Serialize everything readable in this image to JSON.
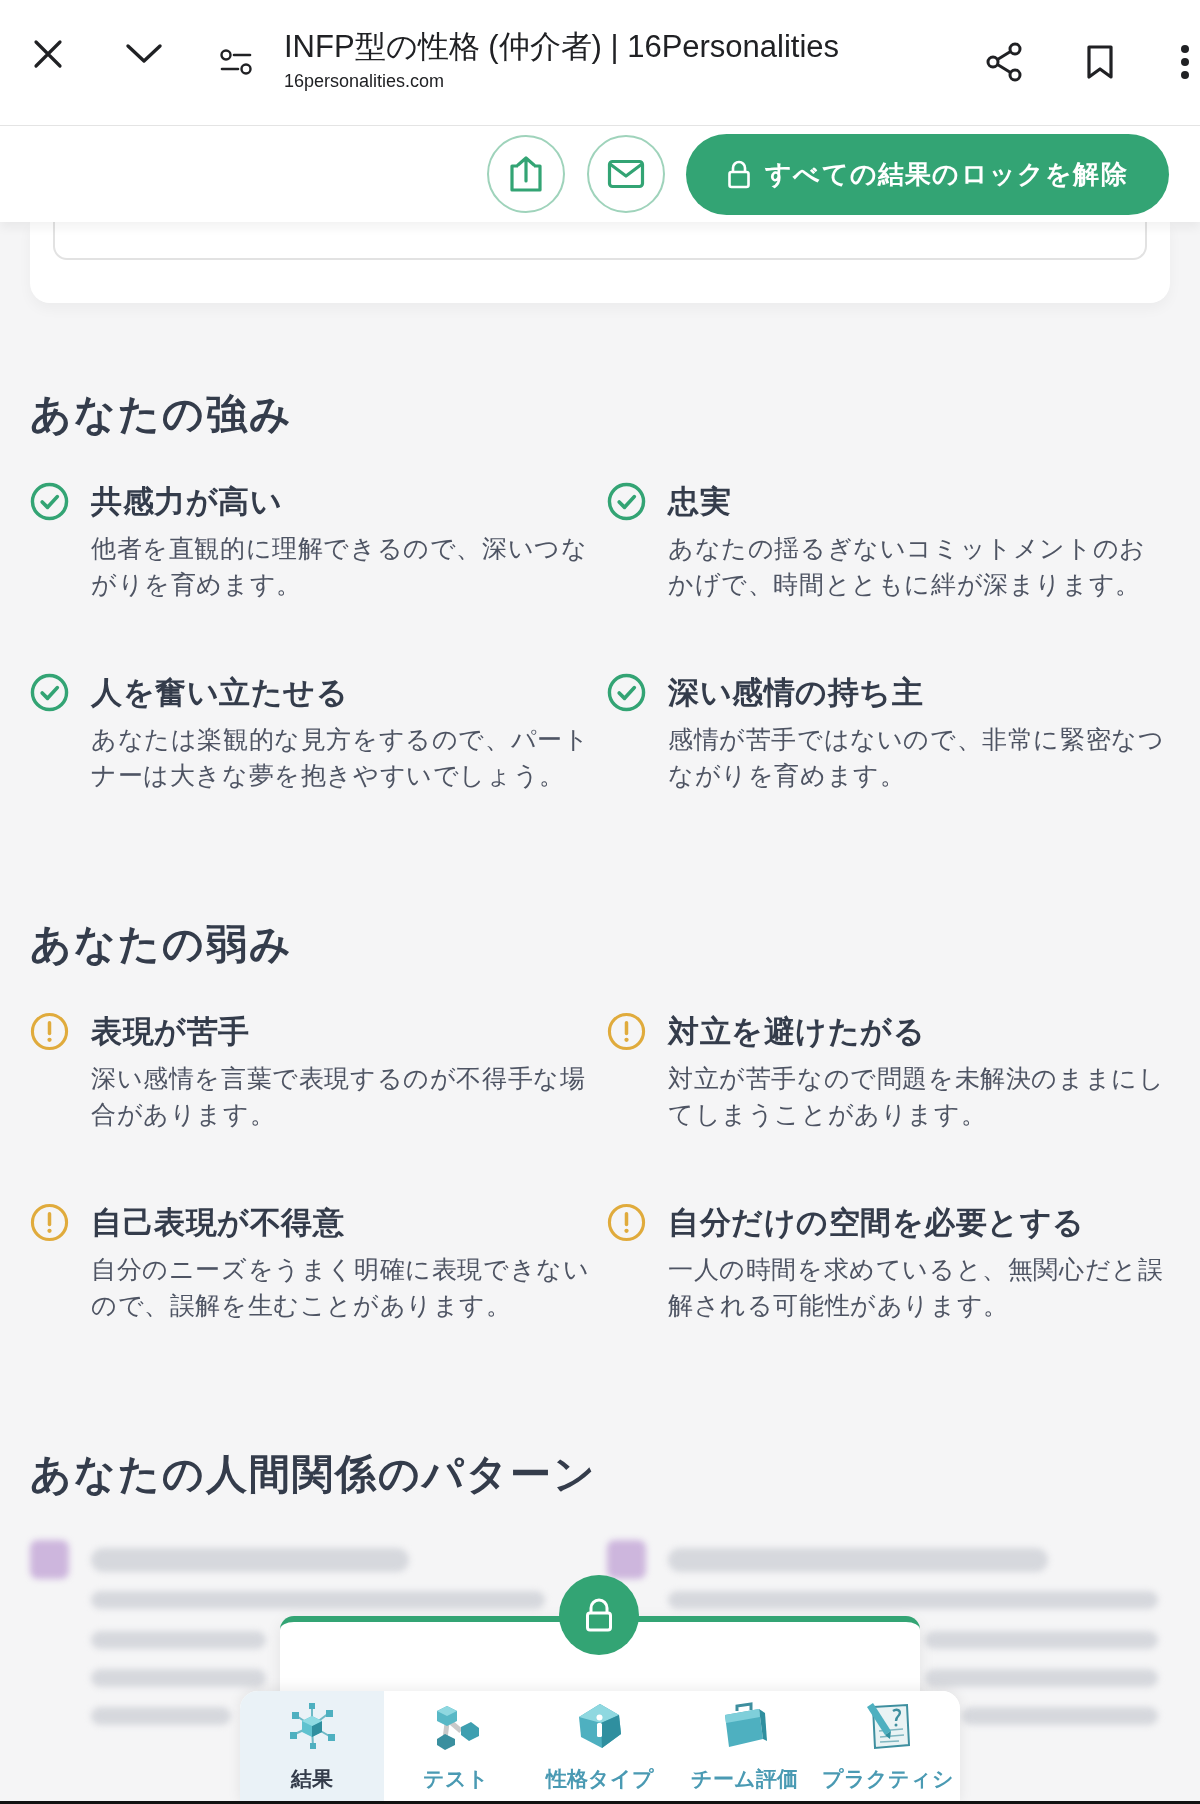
{
  "browser_bar": {
    "title": "INFP型の性格 (仲介者) | 16Personalities",
    "url": "16personalities.com"
  },
  "action_bar": {
    "unlock_button": "すべての結果のロックを解除"
  },
  "sections": [
    {
      "kind": "strengths",
      "heading": "あなたの強み",
      "items": [
        {
          "title": "共感力が高い",
          "text": "他者を直観的に理解できるので、深いつながりを育めます。"
        },
        {
          "title": "忠実",
          "text": "あなたの揺るぎないコミットメントのおかげで、時間とともに絆が深まります。"
        },
        {
          "title": "人を奮い立たせる",
          "text": "あなたは楽観的な見方をするので、パートナーは大きな夢を抱きやすいでしょう。"
        },
        {
          "title": "深い感情の持ち主",
          "text": "感情が苦手ではないので、非常に緊密なつながりを育めます。"
        }
      ]
    },
    {
      "kind": "weaknesses",
      "heading": "あなたの弱み",
      "items": [
        {
          "title": "表現が苦手",
          "text": "深い感情を言葉で表現するのが不得手な場合があります。"
        },
        {
          "title": "対立を避けたがる",
          "text": "対立が苦手なので問題を未解決のままにしてしまうことがあります。"
        },
        {
          "title": "自己表現が不得意",
          "text": "自分のニーズをうまく明確に表現できないので、誤解を生むことがあります。"
        },
        {
          "title": "自分だけの空間を必要とする",
          "text": "一人の時間を求めていると、無関心だと誤解される可能性があります。"
        }
      ]
    },
    {
      "kind": "locked",
      "heading": "あなたの人間関係のパターン"
    }
  ],
  "bottom_nav": [
    {
      "label": "結果",
      "selected": true
    },
    {
      "label": "テスト",
      "selected": false
    },
    {
      "label": "性格タイプ",
      "selected": false
    },
    {
      "label": "チーム評価",
      "selected": false
    },
    {
      "label": "プラクティシ",
      "selected": false
    }
  ]
}
